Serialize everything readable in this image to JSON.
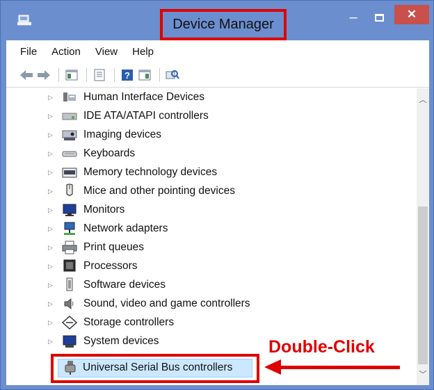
{
  "window": {
    "title": "Device Manager"
  },
  "menu": [
    "File",
    "Action",
    "View",
    "Help"
  ],
  "toolbar": {
    "buttons": [
      "back-arrow-icon",
      "forward-arrow-icon",
      "show-hide-tree-icon",
      "properties-icon",
      "help-icon",
      "view-icon",
      "scan-hardware-icon"
    ]
  },
  "tree": {
    "items": [
      {
        "label": "Human Interface Devices",
        "icon": "hid-icon"
      },
      {
        "label": "IDE ATA/ATAPI controllers",
        "icon": "ide-controller-icon"
      },
      {
        "label": "Imaging devices",
        "icon": "imaging-device-icon"
      },
      {
        "label": "Keyboards",
        "icon": "keyboard-icon"
      },
      {
        "label": "Memory technology devices",
        "icon": "memory-device-icon"
      },
      {
        "label": "Mice and other pointing devices",
        "icon": "mouse-icon"
      },
      {
        "label": "Monitors",
        "icon": "monitor-icon"
      },
      {
        "label": "Network adapters",
        "icon": "network-adapter-icon"
      },
      {
        "label": "Print queues",
        "icon": "printer-icon"
      },
      {
        "label": "Processors",
        "icon": "processor-icon"
      },
      {
        "label": "Software devices",
        "icon": "software-device-icon"
      },
      {
        "label": "Sound, video and game controllers",
        "icon": "speaker-icon"
      },
      {
        "label": "Storage controllers",
        "icon": "storage-controller-icon"
      },
      {
        "label": "System devices",
        "icon": "system-device-icon"
      },
      {
        "label": "Universal Serial Bus controllers",
        "icon": "usb-icon"
      }
    ]
  },
  "annotation": {
    "text": "Double-Click",
    "color": "#e00000"
  },
  "colors": {
    "titlebar": "#6b8ecf",
    "close": "#c9504b",
    "selection": "#cce8ff",
    "highlight": "#e00000"
  }
}
